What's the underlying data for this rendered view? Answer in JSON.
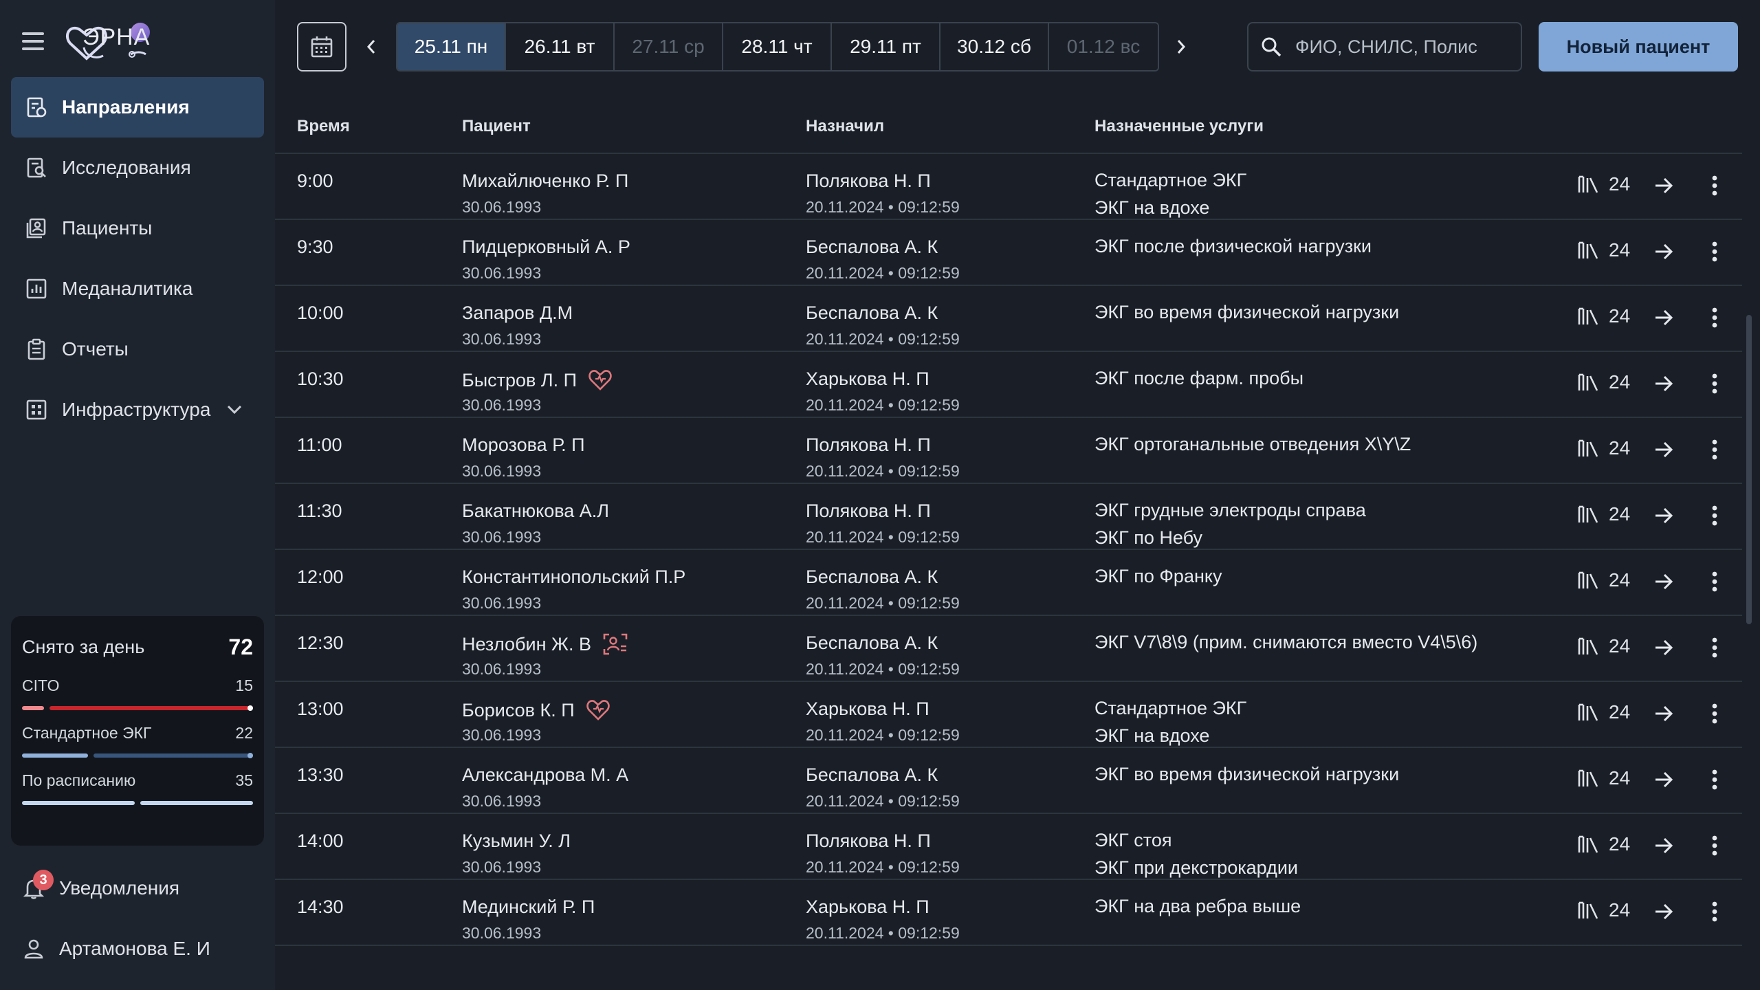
{
  "brand": {
    "logo_text": "ЭРНА"
  },
  "sidebar": {
    "items": [
      {
        "label": "Направления",
        "icon": "referrals-icon",
        "active": true
      },
      {
        "label": "Исследования",
        "icon": "research-icon",
        "active": false
      },
      {
        "label": "Пациенты",
        "icon": "patients-icon",
        "active": false
      },
      {
        "label": "Меданалитика",
        "icon": "analytics-icon",
        "active": false
      },
      {
        "label": "Отчеты",
        "icon": "reports-icon",
        "active": false
      },
      {
        "label": "Инфраструктура",
        "icon": "infrastructure-icon",
        "active": false
      }
    ],
    "stats": {
      "title": "Снято за день",
      "total": "72",
      "rows": [
        {
          "label": "CITO",
          "value": "15",
          "color": "#e2575c"
        },
        {
          "label": "Стандартное ЭКГ",
          "value": "22",
          "color": "#8fb1dc"
        },
        {
          "label": "По расписанию",
          "value": "35",
          "color": "#c3d6ee"
        }
      ]
    },
    "notifications": {
      "label": "Уведомления",
      "count": "3"
    },
    "user": {
      "label": "Артамонова Е. И"
    }
  },
  "topbar": {
    "dates": [
      {
        "label": "25.11 пн",
        "state": "active"
      },
      {
        "label": "26.11 вт",
        "state": "normal"
      },
      {
        "label": "27.11 ср",
        "state": "disabled"
      },
      {
        "label": "28.11 чт",
        "state": "normal"
      },
      {
        "label": "29.11 пт",
        "state": "normal"
      },
      {
        "label": "30.12 сб",
        "state": "normal"
      },
      {
        "label": "01.12 вс",
        "state": "disabled"
      }
    ],
    "search_placeholder": "ФИО, СНИЛС, Полис",
    "new_patient_label": "Новый пациент"
  },
  "table": {
    "headers": {
      "time": "Время",
      "patient": "Пациент",
      "doctor": "Назначил",
      "services": "Назначенные услуги"
    },
    "rows": [
      {
        "time": "9:00",
        "patient": "Михайлюченко Р. П",
        "birth": "30.06.1993",
        "doctor": "Полякова Н. П",
        "assigned": "20.11.2024 • 09:12:59",
        "services": [
          "Стандартное ЭКГ",
          "ЭКГ на вдохе"
        ],
        "count": "24",
        "tag": ""
      },
      {
        "time": "9:30",
        "patient": "Пидцерковный А. Р",
        "birth": "30.06.1993",
        "doctor": "Беспалова А. К",
        "assigned": "20.11.2024 • 09:12:59",
        "services": [
          "ЭКГ после физической нагрузки"
        ],
        "count": "24",
        "tag": ""
      },
      {
        "time": "10:00",
        "patient": "Запаров Д.М",
        "birth": "30.06.1993",
        "doctor": "Беспалова А. К",
        "assigned": "20.11.2024 • 09:12:59",
        "services": [
          "ЭКГ во время физической нагрузки"
        ],
        "count": "24",
        "tag": ""
      },
      {
        "time": "10:30",
        "patient": "Быстров Л. П",
        "birth": "30.06.1993",
        "doctor": "Харькова Н. П",
        "assigned": "20.11.2024 • 09:12:59",
        "services": [
          "ЭКГ после фарм. пробы"
        ],
        "count": "24",
        "tag": "heart"
      },
      {
        "time": "11:00",
        "patient": "Морозова Р. П",
        "birth": "30.06.1993",
        "doctor": "Полякова Н. П",
        "assigned": "20.11.2024 • 09:12:59",
        "services": [
          "ЭКГ ортоганальные отведения X\\Y\\Z"
        ],
        "count": "24",
        "tag": ""
      },
      {
        "time": "11:30",
        "patient": "Бакатнюкова А.Л",
        "birth": "30.06.1993",
        "doctor": "Полякова Н. П",
        "assigned": "20.11.2024 • 09:12:59",
        "services": [
          "ЭКГ грудные электроды справа",
          "ЭКГ по Небу"
        ],
        "count": "24",
        "tag": ""
      },
      {
        "time": "12:00",
        "patient": "Константинопольский П.Р",
        "birth": "30.06.1993",
        "doctor": "Беспалова А. К",
        "assigned": "20.11.2024 • 09:12:59",
        "services": [
          "ЭКГ по Франку"
        ],
        "count": "24",
        "tag": ""
      },
      {
        "time": "12:30",
        "patient": "Незлобин Ж. В",
        "birth": "30.06.1993",
        "doctor": "Беспалова А. К",
        "assigned": "20.11.2024 • 09:12:59",
        "services": [
          "ЭКГ V7\\8\\9 (прим. снимаются вместо V4\\5\\6)"
        ],
        "count": "24",
        "tag": "person"
      },
      {
        "time": "13:00",
        "patient": "Борисов К. П",
        "birth": "30.06.1993",
        "doctor": "Харькова Н. П",
        "assigned": "20.11.2024 • 09:12:59",
        "services": [
          "Стандартное ЭКГ",
          "ЭКГ на вдохе"
        ],
        "count": "24",
        "tag": "heart"
      },
      {
        "time": "13:30",
        "patient": "Александрова М. А",
        "birth": "30.06.1993",
        "doctor": "Беспалова А. К",
        "assigned": "20.11.2024 • 09:12:59",
        "services": [
          "ЭКГ во время физической нагрузки"
        ],
        "count": "24",
        "tag": ""
      },
      {
        "time": "14:00",
        "patient": "Кузьмин У. Л",
        "birth": "30.06.1993",
        "doctor": "Полякова Н. П",
        "assigned": "20.11.2024 • 09:12:59",
        "services": [
          "ЭКГ стоя",
          "ЭКГ при декстрокардии"
        ],
        "count": "24",
        "tag": ""
      },
      {
        "time": "14:30",
        "patient": "Мединский Р. П",
        "birth": "30.06.1993",
        "doctor": "Харькова Н. П",
        "assigned": "20.11.2024 • 09:12:59",
        "services": [
          "ЭКГ на два ребра выше"
        ],
        "count": "24",
        "tag": ""
      }
    ]
  }
}
